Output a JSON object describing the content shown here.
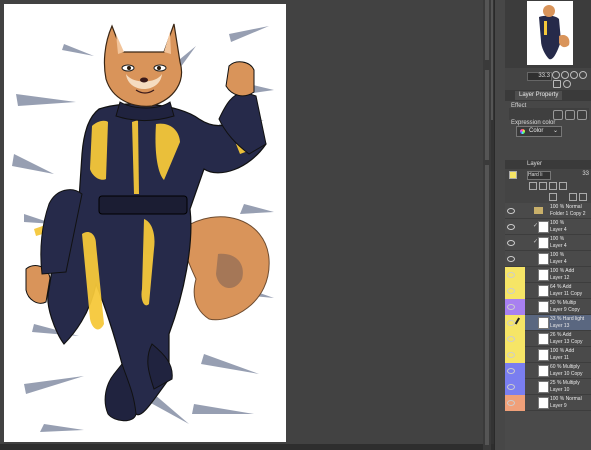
{
  "navigator": {
    "zoom": "33.3"
  },
  "property_panel": {
    "tab_label": "Layer Property",
    "effect_label": "Effect",
    "expression_color_label": "Expression color",
    "expression_color_value": "Color"
  },
  "layer_panel": {
    "tab_label": "Layer",
    "blend_mode": "Hard li",
    "opacity": "33",
    "layers": [
      {
        "mode": "100 % Normal",
        "name": "Folder 1 Copy 2",
        "type": "folder",
        "color": ""
      },
      {
        "mode": "100 %",
        "name": "Layer 4",
        "type": "layer",
        "color": "",
        "clip": "✓"
      },
      {
        "mode": "100 %",
        "name": "Layer 4",
        "type": "layer",
        "color": "",
        "clip": "✓"
      },
      {
        "mode": "100 %",
        "name": "Layer 4",
        "type": "layer",
        "color": "",
        "clip": ""
      },
      {
        "mode": "100 % Add",
        "name": "Layer 12",
        "type": "layer",
        "color": "#f6e566"
      },
      {
        "mode": "64 % Add",
        "name": "Layer 11 Copy",
        "type": "layer",
        "color": "#f6e566"
      },
      {
        "mode": "50 % Multip",
        "name": "Layer 9 Copy",
        "type": "layer",
        "color": "#a880f0"
      },
      {
        "mode": "33 % Hard light",
        "name": "Layer 13",
        "type": "layer",
        "color": "#f6e566",
        "selected": true
      },
      {
        "mode": "26 % Add",
        "name": "Layer 13 Copy",
        "type": "layer",
        "color": "#f6e566"
      },
      {
        "mode": "100 % Add",
        "name": "Layer 11",
        "type": "layer",
        "color": "#f6e566"
      },
      {
        "mode": "60 % Multiply",
        "name": "Layer 10 Copy",
        "type": "layer",
        "color": "#7a7ef0"
      },
      {
        "mode": "25 % Multiply",
        "name": "Layer 10",
        "type": "layer",
        "color": "#7a7ef0"
      },
      {
        "mode": "100 % Normal",
        "name": "Layer 9",
        "type": "layer",
        "color": "#f0a079"
      }
    ]
  },
  "colors": {
    "fur": "#d9945a",
    "suit": "#262a4a",
    "gold": "#f5c83a",
    "shadow": "#8a93a8"
  }
}
